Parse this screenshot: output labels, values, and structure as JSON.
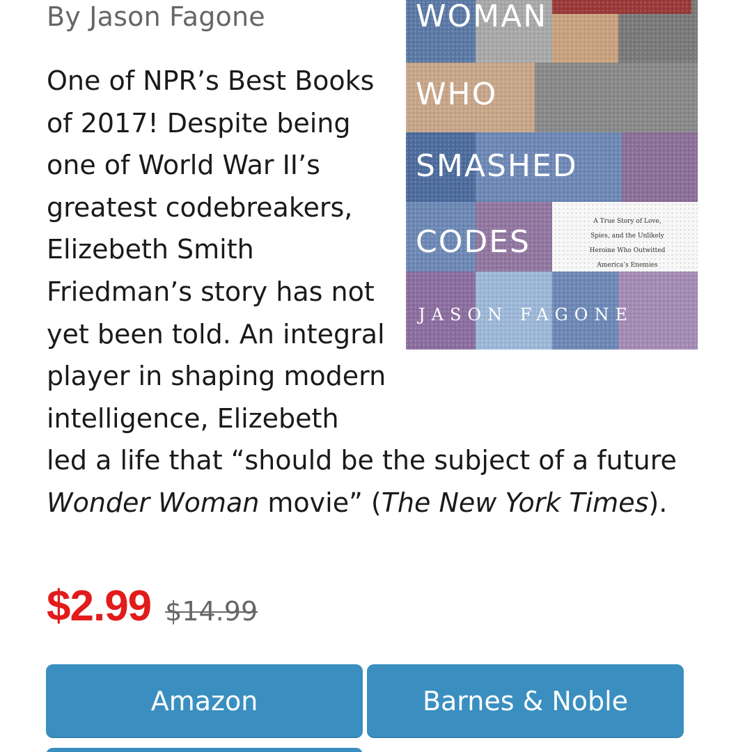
{
  "book": {
    "author_line": "By Jason Fagone",
    "description_narrow": "One of NPR’s Best Books of 2017! Despite being one of World War II’s greatest codebreakers, Elizebeth Smith Friedman’s story has not yet been told. An integral player in shaping modern intelligence, Elizebeth",
    "description_wide_prefix": "led a life that “should be the subject of a future ",
    "description_em1": "Wonder Woman",
    "description_mid": " movie” (",
    "description_em2": "The New York Times",
    "description_suffix": ").",
    "cover": {
      "title_lines": [
        "WOMAN",
        "WHO",
        "SMASHED",
        "CODES"
      ],
      "subtitle_lines": [
        "A True Story of Love,",
        "Spies, and the Unlikely",
        "Heroine Who Outwitted",
        "America’s Enemies"
      ],
      "author": "JASON FAGONE"
    }
  },
  "pricing": {
    "sale_price": "$2.99",
    "original_price": "$14.99",
    "sale_color": "#e21b1b"
  },
  "buttons": {
    "amazon_label": "Amazon",
    "bn_label": "Barnes & Noble",
    "button_color": "#3a8fc0"
  }
}
